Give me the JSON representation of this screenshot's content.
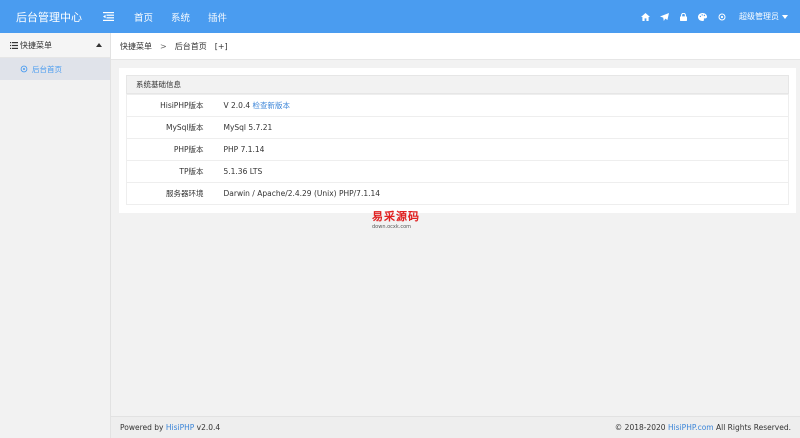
{
  "header": {
    "logo": "后台管理中心",
    "nav": [
      "首页",
      "系统",
      "插件"
    ],
    "admin_label": "超级管理员",
    "icons": [
      "home-icon",
      "send-icon",
      "lock-icon",
      "palette-icon",
      "gear-icon"
    ]
  },
  "sidebar": {
    "section_title": "快捷菜单",
    "items": [
      {
        "label": "后台首页"
      }
    ]
  },
  "breadcrumb": {
    "root": "快捷菜单",
    "separator": ">",
    "current": "后台首页",
    "add": "[+]"
  },
  "panel": {
    "title": "系统基础信息",
    "rows": [
      {
        "label": "HisiPHP版本",
        "value": "V 2.0.4",
        "link": "检查新版本"
      },
      {
        "label": "MySql版本",
        "value": "MySql 5.7.21"
      },
      {
        "label": "PHP版本",
        "value": "PHP 7.1.14"
      },
      {
        "label": "TP版本",
        "value": "5.1.36 LTS"
      },
      {
        "label": "服务器环境",
        "value": "Darwin / Apache/2.4.29 (Unix) PHP/7.1.14"
      }
    ]
  },
  "watermark": {
    "text": "易采源码",
    "sub": "down.ocxk.com"
  },
  "footer": {
    "powered_prefix": "Powered by",
    "powered_name": "HisiPHP",
    "powered_version": "v2.0.4",
    "copyright_prefix": "© 2018-2020",
    "copyright_site": "HisiPHP.com",
    "copyright_suffix": "All Rights Reserved."
  },
  "colors": {
    "header_bg": "#4a9cf0",
    "link": "#3b85d8",
    "watermark": "#e02020"
  }
}
